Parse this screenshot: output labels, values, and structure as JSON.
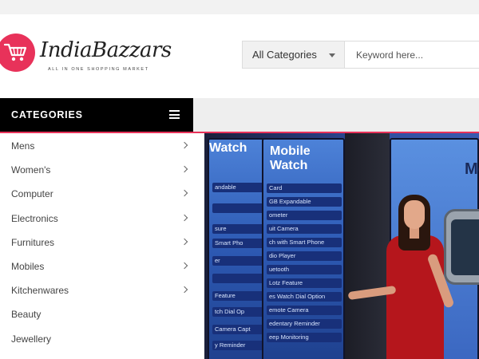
{
  "brand": {
    "name": "IndiaBazzars",
    "tagline": "ALL IN ONE SHOPPING MARKET",
    "color": "#e8325a"
  },
  "search": {
    "category_selected": "All Categories",
    "placeholder": "Keyword here..."
  },
  "categories": {
    "title": "CATEGORIES",
    "items": [
      {
        "label": "Mens",
        "has_submenu": true
      },
      {
        "label": "Women's",
        "has_submenu": true
      },
      {
        "label": "Computer",
        "has_submenu": true
      },
      {
        "label": "Electronics",
        "has_submenu": true
      },
      {
        "label": "Furnitures",
        "has_submenu": true
      },
      {
        "label": "Mobiles",
        "has_submenu": true
      },
      {
        "label": "Kitchenwares",
        "has_submenu": true
      },
      {
        "label": "Beauty",
        "has_submenu": false
      },
      {
        "label": "Jewellery",
        "has_submenu": false
      }
    ]
  },
  "banner": {
    "board1_title": "Watch",
    "board1_rows": [
      "andable",
      "",
      "sure",
      "Smart Pho",
      "er",
      "",
      "Feature",
      "tch Dial Op",
      "Camera Capt",
      "y Reminder"
    ],
    "board2_title": "Mobile Watch",
    "board2_rows": [
      "Card",
      "GB Expandable",
      "ometer",
      "uit Camera",
      "ch with Smart Phone",
      "dio Player",
      "uetooth",
      "Lotz Feature",
      "es Watch Dial Option",
      "emote Camera",
      "edentary Reminder",
      "eep Monitoring"
    ],
    "board3_title": "Mo"
  }
}
